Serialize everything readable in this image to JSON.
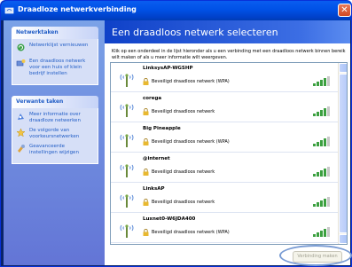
{
  "window": {
    "title": "Draadloze netwerkverbinding",
    "close_glyph": "✕"
  },
  "sidebar": {
    "groups": [
      {
        "header": "Netwerktaken",
        "tasks": [
          {
            "label": "Netwerklijst vernieuwen",
            "icon": "refresh-icon"
          },
          {
            "label": "Een draadloos netwerk voor een huis of klein bedrijf instellen",
            "icon": "setup-network-icon"
          }
        ]
      },
      {
        "header": "Verwante taken",
        "tasks": [
          {
            "label": "Meer informatie over draadloze netwerken",
            "icon": "info-icon"
          },
          {
            "label": "De volgorde van voorkeursnetwerken",
            "icon": "star-icon"
          },
          {
            "label": "Geavanceerde instellingen wijzigen",
            "icon": "settings-icon"
          }
        ]
      }
    ]
  },
  "main": {
    "title": "Een draadloos netwerk selecteren",
    "instructions": "Klik op een onderdeel in de lijst hieronder als u een verbinding met een draadloos netwerk binnen bereik wilt maken of als u meer informatie wilt weergeven.",
    "networks": [
      {
        "name": "LinksysAP-WGSHP",
        "security": "Beveiligd draadloos netwerk (WPA)",
        "signal": 0.8
      },
      {
        "name": "corega",
        "security": "Beveiligd draadloos netwerk",
        "signal": 0.8
      },
      {
        "name": "Big Pineapple",
        "security": "Beveiligd draadloos netwerk (WPA)",
        "signal": 0.8
      },
      {
        "name": "@internet",
        "security": "Beveiligd draadloos netwerk",
        "signal": 0.8
      },
      {
        "name": "LinksAP",
        "security": "Beveiligd draadloos netwerk",
        "signal": 0.8
      },
      {
        "name": "Luxnet0-W6JDA400",
        "security": "Beveiligd draadloos netwerk (WPA)",
        "signal": 0.8
      }
    ],
    "connect_button": "Verbinding maken"
  },
  "colors": {
    "title_bar": "#0054e3",
    "sidebar": "#7ba2e7",
    "link": "#215dc6",
    "highlight": "#7a9cd4"
  }
}
